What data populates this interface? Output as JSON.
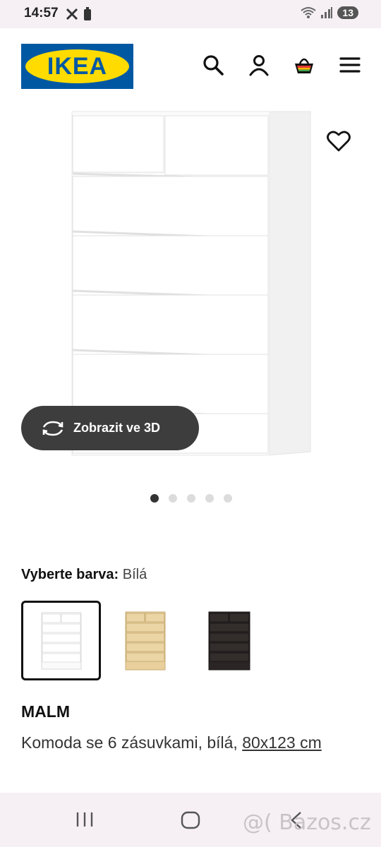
{
  "status_bar": {
    "time": "14:57",
    "notification_count": "13"
  },
  "header": {
    "logo_text": "IKEA",
    "brand_colors": {
      "blue": "#0058a3",
      "yellow": "#ffdb00"
    },
    "icons": [
      "search-icon",
      "account-icon",
      "cart-icon",
      "menu-icon"
    ]
  },
  "gallery": {
    "view_3d_label": "Zobrazit ve 3D",
    "image_count": 5,
    "active_index": 0
  },
  "color_select": {
    "label": "Vyberte barva:",
    "value": "Bílá",
    "options": [
      {
        "name": "white",
        "hex": "#ffffff",
        "selected": true
      },
      {
        "name": "oak-veneer",
        "hex": "#e8cf9b",
        "selected": false
      },
      {
        "name": "black-brown",
        "hex": "#2b2625",
        "selected": false
      }
    ]
  },
  "product": {
    "name": "MALM",
    "description": "Komoda se 6 zásuvkami, bílá,",
    "dimensions": "80x123 cm"
  },
  "watermark": "@( Bazos.cz"
}
